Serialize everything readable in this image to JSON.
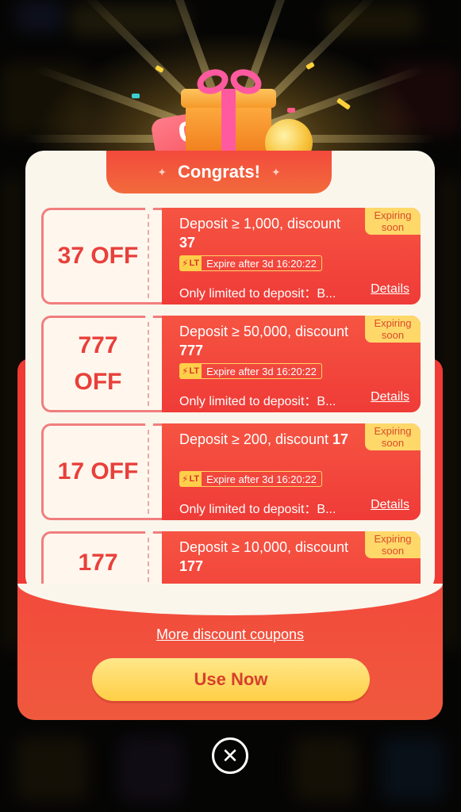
{
  "header": {
    "title": "Congrats!"
  },
  "coupons": [
    {
      "off_label": "37 OFF",
      "condition": "Deposit ≥ 1,000, discount",
      "amount": "37",
      "badge_line1": "Expiring",
      "badge_line2": "soon",
      "lt_tag": "LT",
      "expire_text": "Expire after 3d 16:20:22",
      "restriction": "Only limited to deposit：B...",
      "details_label": "Details"
    },
    {
      "off_label": "777 OFF",
      "condition": "Deposit ≥ 50,000, discount",
      "amount": "777",
      "badge_line1": "Expiring",
      "badge_line2": "soon",
      "lt_tag": "LT",
      "expire_text": "Expire after 3d 16:20:22",
      "restriction": "Only limited to deposit：B...",
      "details_label": "Details"
    },
    {
      "off_label": "17 OFF",
      "condition": "Deposit ≥ 200, discount",
      "amount": "17",
      "badge_line1": "Expiring",
      "badge_line2": "soon",
      "lt_tag": "LT",
      "expire_text": "Expire after 3d 16:20:22",
      "restriction": "Only limited to deposit：B...",
      "details_label": "Details"
    },
    {
      "off_label": "177",
      "condition": "Deposit ≥ 10,000, discount",
      "amount": "177",
      "badge_line1": "Expiring",
      "badge_line2": "soon"
    }
  ],
  "footer": {
    "more_link": "More discount coupons",
    "use_button": "Use Now"
  },
  "icons": {
    "close": "close-icon",
    "lightning": "lightning-icon",
    "gift": "gift-icon",
    "coin": "coin-icon",
    "sparkle": "sparkle-icon"
  },
  "colors": {
    "accent_red": "#ef3b37",
    "badge_yellow": "#ffd86a",
    "button_yellow": "#ffdc5e",
    "card_bg": "#fbf6ec"
  }
}
